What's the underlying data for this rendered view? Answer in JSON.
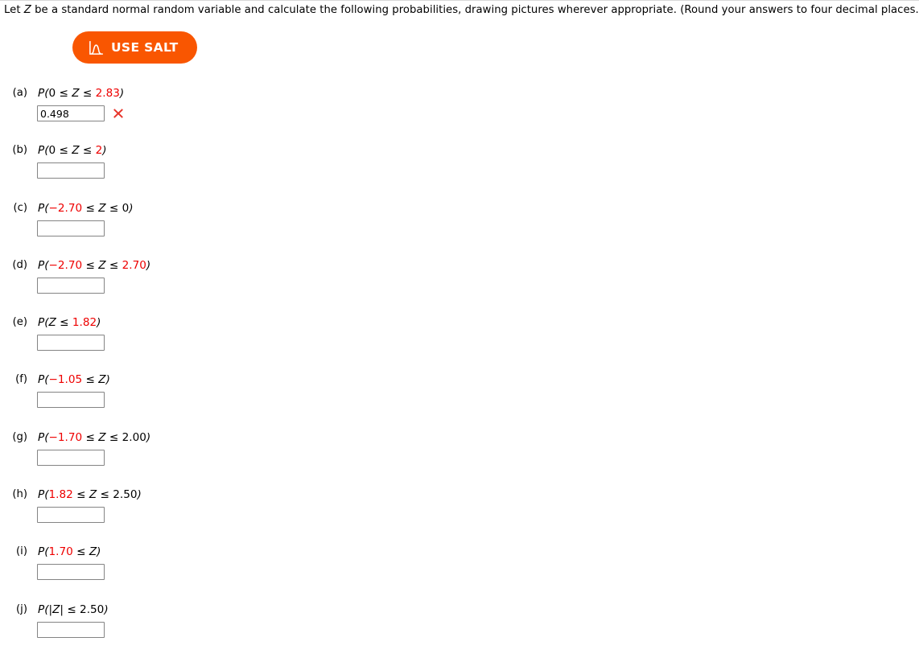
{
  "prompt": {
    "before_var": "Let ",
    "var": "Z",
    "after_var": " be a standard normal random variable and calculate the following probabilities, drawing pictures wherever appropriate. (Round your answers to four decimal places.)"
  },
  "salt_button": {
    "label": "USE SALT",
    "icon": "normal-curve-icon",
    "background_color": "#f95601",
    "text_color": "#ffffff"
  },
  "colors": {
    "highlight_red": "#ee0000",
    "wrong_mark_red": "#e8352b",
    "input_border": "#848484"
  },
  "items": [
    {
      "label": "(a)",
      "expr": [
        {
          "t": "P(",
          "style": "italic",
          "color": "black"
        },
        {
          "t": "0",
          "style": "normal",
          "color": "black"
        },
        {
          "t": " ≤ ",
          "style": "normal",
          "color": "black"
        },
        {
          "t": "Z",
          "style": "italic",
          "color": "black"
        },
        {
          "t": " ≤ ",
          "style": "normal",
          "color": "black"
        },
        {
          "t": "2.83",
          "style": "normal",
          "color": "red"
        },
        {
          "t": ")",
          "style": "italic",
          "color": "black"
        }
      ],
      "expr_text": "P(0 ≤ Z ≤ 2.83)",
      "value": "0.498",
      "placeholder": "",
      "mark": "wrong"
    },
    {
      "label": "(b)",
      "expr": [
        {
          "t": "P(",
          "style": "italic",
          "color": "black"
        },
        {
          "t": "0",
          "style": "normal",
          "color": "black"
        },
        {
          "t": " ≤ ",
          "style": "normal",
          "color": "black"
        },
        {
          "t": "Z",
          "style": "italic",
          "color": "black"
        },
        {
          "t": " ≤ ",
          "style": "normal",
          "color": "black"
        },
        {
          "t": "2",
          "style": "normal",
          "color": "red"
        },
        {
          "t": ")",
          "style": "italic",
          "color": "black"
        }
      ],
      "expr_text": "P(0 ≤ Z ≤ 2)",
      "value": "",
      "placeholder": "",
      "mark": "none"
    },
    {
      "label": "(c)",
      "expr": [
        {
          "t": "P(",
          "style": "italic",
          "color": "black"
        },
        {
          "t": "−2.70",
          "style": "normal",
          "color": "red"
        },
        {
          "t": " ≤ ",
          "style": "normal",
          "color": "black"
        },
        {
          "t": "Z",
          "style": "italic",
          "color": "black"
        },
        {
          "t": " ≤ ",
          "style": "normal",
          "color": "black"
        },
        {
          "t": "0",
          "style": "normal",
          "color": "black"
        },
        {
          "t": ")",
          "style": "italic",
          "color": "black"
        }
      ],
      "expr_text": "P(−2.70 ≤ Z ≤ 0)",
      "value": "",
      "placeholder": "",
      "mark": "none"
    },
    {
      "label": "(d)",
      "expr": [
        {
          "t": "P(",
          "style": "italic",
          "color": "black"
        },
        {
          "t": "−2.70",
          "style": "normal",
          "color": "red"
        },
        {
          "t": " ≤ ",
          "style": "normal",
          "color": "black"
        },
        {
          "t": "Z",
          "style": "italic",
          "color": "black"
        },
        {
          "t": " ≤ ",
          "style": "normal",
          "color": "black"
        },
        {
          "t": "2.70",
          "style": "normal",
          "color": "red"
        },
        {
          "t": ")",
          "style": "italic",
          "color": "black"
        }
      ],
      "expr_text": "P(−2.70 ≤ Z ≤ 2.70)",
      "value": "",
      "placeholder": "",
      "mark": "none"
    },
    {
      "label": "(e)",
      "expr": [
        {
          "t": "P(",
          "style": "italic",
          "color": "black"
        },
        {
          "t": "Z",
          "style": "italic",
          "color": "black"
        },
        {
          "t": " ≤ ",
          "style": "normal",
          "color": "black"
        },
        {
          "t": "1.82",
          "style": "normal",
          "color": "red"
        },
        {
          "t": ")",
          "style": "italic",
          "color": "black"
        }
      ],
      "expr_text": "P(Z ≤ 1.82)",
      "value": "",
      "placeholder": "",
      "mark": "none"
    },
    {
      "label": "(f)",
      "expr": [
        {
          "t": "P(",
          "style": "italic",
          "color": "black"
        },
        {
          "t": "−1.05",
          "style": "normal",
          "color": "red"
        },
        {
          "t": " ≤ ",
          "style": "normal",
          "color": "black"
        },
        {
          "t": "Z",
          "style": "italic",
          "color": "black"
        },
        {
          "t": ")",
          "style": "italic",
          "color": "black"
        }
      ],
      "expr_text": "P(−1.05 ≤ Z)",
      "value": "",
      "placeholder": "",
      "mark": "none"
    },
    {
      "label": "(g)",
      "expr": [
        {
          "t": "P(",
          "style": "italic",
          "color": "black"
        },
        {
          "t": "−1.70",
          "style": "normal",
          "color": "red"
        },
        {
          "t": " ≤ ",
          "style": "normal",
          "color": "black"
        },
        {
          "t": "Z",
          "style": "italic",
          "color": "black"
        },
        {
          "t": " ≤ ",
          "style": "normal",
          "color": "black"
        },
        {
          "t": "2.00",
          "style": "normal",
          "color": "black"
        },
        {
          "t": ")",
          "style": "italic",
          "color": "black"
        }
      ],
      "expr_text": "P(−1.70 ≤ Z ≤ 2.00)",
      "value": "",
      "placeholder": "",
      "mark": "none"
    },
    {
      "label": "(h)",
      "expr": [
        {
          "t": "P(",
          "style": "italic",
          "color": "black"
        },
        {
          "t": "1.82",
          "style": "normal",
          "color": "red"
        },
        {
          "t": " ≤ ",
          "style": "normal",
          "color": "black"
        },
        {
          "t": "Z",
          "style": "italic",
          "color": "black"
        },
        {
          "t": " ≤ ",
          "style": "normal",
          "color": "black"
        },
        {
          "t": "2.50",
          "style": "normal",
          "color": "black"
        },
        {
          "t": ")",
          "style": "italic",
          "color": "black"
        }
      ],
      "expr_text": "P(1.82 ≤ Z ≤ 2.50)",
      "value": "",
      "placeholder": "",
      "mark": "none"
    },
    {
      "label": "(i)",
      "expr": [
        {
          "t": "P(",
          "style": "italic",
          "color": "black"
        },
        {
          "t": "1.70",
          "style": "normal",
          "color": "red"
        },
        {
          "t": " ≤ ",
          "style": "normal",
          "color": "black"
        },
        {
          "t": "Z",
          "style": "italic",
          "color": "black"
        },
        {
          "t": ")",
          "style": "italic",
          "color": "black"
        }
      ],
      "expr_text": "P(1.70 ≤ Z)",
      "value": "",
      "placeholder": "",
      "mark": "none"
    },
    {
      "label": "(j)",
      "expr": [
        {
          "t": "P(|",
          "style": "italic",
          "color": "black"
        },
        {
          "t": "Z",
          "style": "italic",
          "color": "black"
        },
        {
          "t": "| ≤ ",
          "style": "normal",
          "color": "black"
        },
        {
          "t": "2.50",
          "style": "normal",
          "color": "black"
        },
        {
          "t": ")",
          "style": "italic",
          "color": "black"
        }
      ],
      "expr_text": "P(|Z| ≤ 2.50)",
      "value": "",
      "placeholder": "",
      "mark": "none"
    }
  ]
}
